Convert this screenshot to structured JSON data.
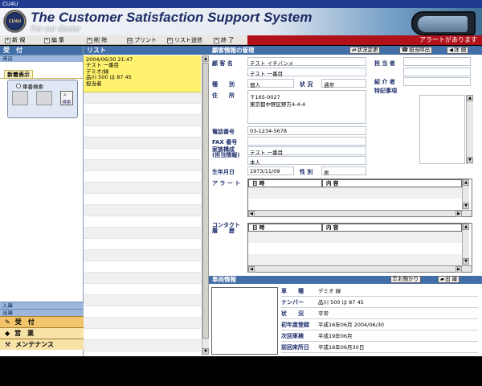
{
  "window": {
    "title": "CU4U"
  },
  "banner": {
    "logo_text": "CU4U",
    "title": "The Customer Satisfaction Support System",
    "subtitle": "For car dealer"
  },
  "toolbar": {
    "items": [
      "新 規",
      "編 集",
      "削 除",
      "プリント",
      "リスト送信",
      "終 了"
    ],
    "alert": "アラートがあります"
  },
  "left": {
    "header": "受　付",
    "sub1": "来店",
    "new_tab": "新着表示",
    "search_label": "車番検索",
    "search_btn": "検索",
    "sub2": "入庫",
    "sub3": "出庫",
    "nav": [
      "受　付",
      "営　業",
      "メンテナンス"
    ]
  },
  "list": {
    "header": "リスト",
    "item": {
      "line1": "2004/06/30 21:47",
      "line2": "テスト 一番目",
      "line3": "デミオ/緑",
      "line4": "品川 500 は 87 45",
      "line5": "担当者"
    }
  },
  "customer": {
    "header": "顧客情報の管理",
    "btn_status": "状況変更",
    "btn_assign": "担当呼出",
    "btn_detail": "詳 細",
    "labels": {
      "name": "顧 客 名",
      "type": "種　　別",
      "status": "状 況",
      "address": "住　　所",
      "phone": "電話番号",
      "fax": "FAX 番号",
      "family": "家族構成\n(担当情報)",
      "birth": "生年月日",
      "gender": "性 別",
      "alert": "ア ラ ー ト",
      "contact": "コンタクト\n履　　歴",
      "staff": "担 当 者",
      "introducer": "紹 介 者",
      "notes": "特記事項"
    },
    "values": {
      "name_kana": "テスト イチバンメ",
      "name": "テスト 一番目",
      "type": "個人",
      "status": "通常",
      "zip": "〒165-0027",
      "address": "東京都中野区野方4-4-4",
      "phone": "03-1234-5678",
      "family1": "テスト 一番目",
      "family2": "本人",
      "birth": "1973/11/09",
      "gender": "男"
    },
    "grid_cols": [
      "日 時",
      "内 容"
    ]
  },
  "vehicle": {
    "header": "車両情報",
    "btn_keep": "お預かり",
    "btn_out": "出 庫",
    "rows": [
      {
        "label": "車　　種",
        "value": "デミオ 緑"
      },
      {
        "label": "ナンバー",
        "value": "品川 500 は 87 45"
      },
      {
        "label": "状　　況",
        "value": "平常"
      },
      {
        "label": "初年度登録",
        "value": "平成16年06月 2004/06/30"
      },
      {
        "label": "次回車検",
        "value": "平成19年06月"
      },
      {
        "label": "前回来所日",
        "value": "平成16年06月30日"
      }
    ]
  },
  "colors": {
    "header_blue": "#436fa8",
    "alert_red": "#b1121a",
    "list_yellow": "#fff26e",
    "nav_gold": "#f3c56a"
  }
}
